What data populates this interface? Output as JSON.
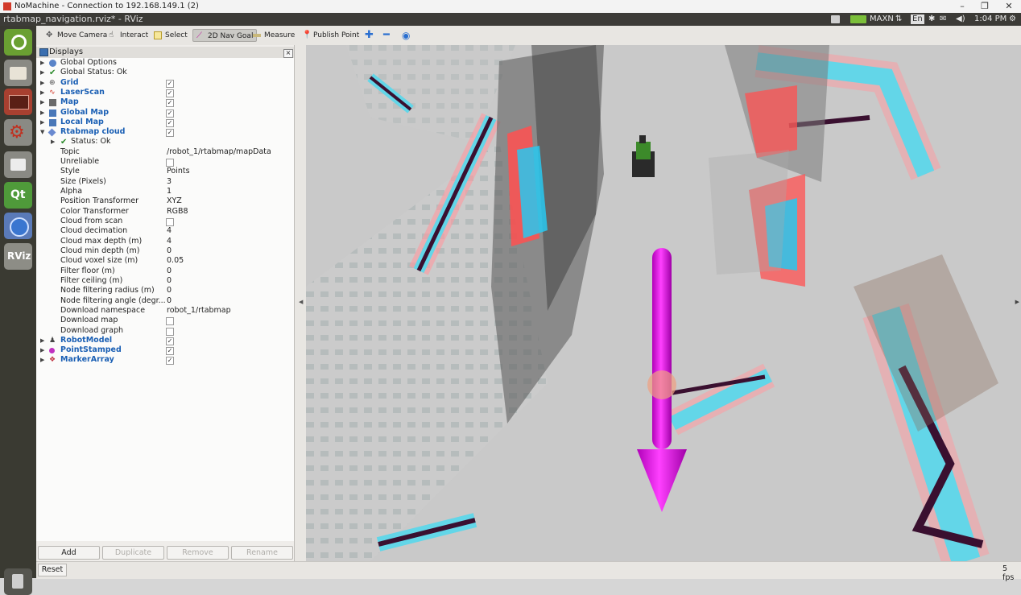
{
  "nomachine": {
    "title": "NoMachine - Connection to 192.168.149.1 (2)"
  },
  "window_title": "rtabmap_navigation.rviz* - RViz",
  "tray": {
    "power_mode": "MAXN",
    "keyboard": "En",
    "time": "1:04 PM"
  },
  "launcher": [
    "ubuntu-home",
    "files",
    "terminal",
    "settings",
    "disk",
    "qt-creator",
    "chromium",
    "rviz"
  ],
  "toolbar": {
    "tools": [
      {
        "label": "Move Camera",
        "icon": "move-camera-icon"
      },
      {
        "label": "Interact",
        "icon": "hand-icon"
      },
      {
        "label": "Select",
        "icon": "select-icon"
      },
      {
        "label": "2D Nav Goal",
        "icon": "nav-goal-icon",
        "active": true
      },
      {
        "label": "Measure",
        "icon": "ruler-icon"
      },
      {
        "label": "Publish Point",
        "icon": "pin-icon"
      }
    ]
  },
  "displays": {
    "title": "Displays",
    "items": [
      {
        "label": "Global Options",
        "kind": "group"
      },
      {
        "label": "Global Status: Ok",
        "kind": "status"
      },
      {
        "label": "Grid",
        "checked": true
      },
      {
        "label": "LaserScan",
        "checked": true
      },
      {
        "label": "Map",
        "checked": true
      },
      {
        "label": "Global Map",
        "checked": true
      },
      {
        "label": "Local Map",
        "checked": true
      },
      {
        "label": "Rtabmap cloud",
        "checked": true,
        "expanded": true
      },
      {
        "label": "Status: Ok",
        "kind": "substatus"
      }
    ],
    "properties": [
      {
        "name": "Topic",
        "value": "/robot_1/rtabmap/mapData"
      },
      {
        "name": "Unreliable",
        "value": null,
        "checkbox": false
      },
      {
        "name": "Style",
        "value": "Points"
      },
      {
        "name": "Size (Pixels)",
        "value": "3"
      },
      {
        "name": "Alpha",
        "value": "1"
      },
      {
        "name": "Position Transformer",
        "value": "XYZ"
      },
      {
        "name": "Color Transformer",
        "value": "RGB8"
      },
      {
        "name": "Cloud from scan",
        "value": null,
        "checkbox": false
      },
      {
        "name": "Cloud decimation",
        "value": "4"
      },
      {
        "name": "Cloud max depth (m)",
        "value": "4"
      },
      {
        "name": "Cloud min depth (m)",
        "value": "0"
      },
      {
        "name": "Cloud voxel size (m)",
        "value": "0.05"
      },
      {
        "name": "Filter floor (m)",
        "value": "0"
      },
      {
        "name": "Filter ceiling (m)",
        "value": "0"
      },
      {
        "name": "Node filtering radius (m)",
        "value": "0"
      },
      {
        "name": "Node filtering angle (degr...",
        "value": "0"
      },
      {
        "name": "Download namespace",
        "value": "robot_1/rtabmap"
      },
      {
        "name": "Download map",
        "value": null,
        "checkbox": false
      },
      {
        "name": "Download graph",
        "value": null,
        "checkbox": false
      }
    ],
    "more_items": [
      {
        "label": "RobotModel",
        "checked": true
      },
      {
        "label": "PointStamped",
        "checked": true
      },
      {
        "label": "MarkerArray",
        "checked": true
      }
    ],
    "buttons": {
      "add": "Add",
      "duplicate": "Duplicate",
      "remove": "Remove",
      "rename": "Rename"
    }
  },
  "status": {
    "reset": "Reset",
    "fps": "5 fps"
  }
}
